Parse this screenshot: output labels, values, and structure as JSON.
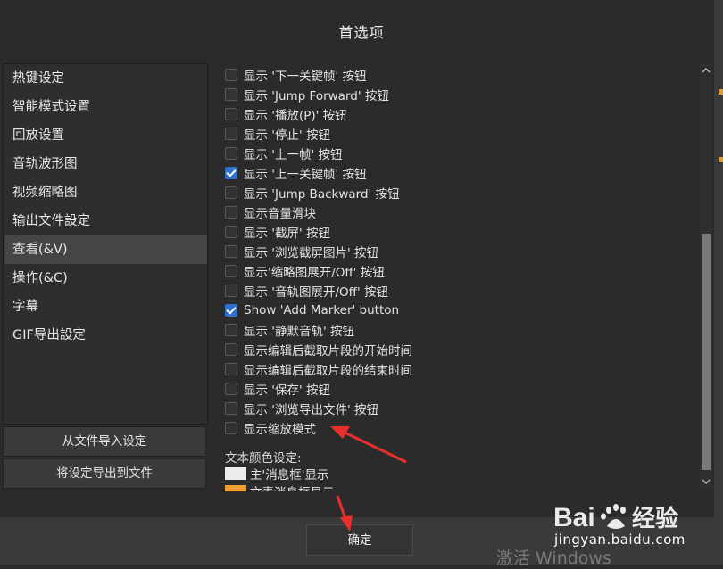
{
  "window": {
    "title": "首选项"
  },
  "sidebar": {
    "items": [
      {
        "label": "热键设定"
      },
      {
        "label": "智能模式设置"
      },
      {
        "label": "回放设置"
      },
      {
        "label": "音轨波形图"
      },
      {
        "label": "视频缩略图"
      },
      {
        "label": "输出文件設定"
      },
      {
        "label": "查看(&V)"
      },
      {
        "label": "操作(&C)"
      },
      {
        "label": "字幕"
      },
      {
        "label": "GIF导出設定"
      }
    ],
    "active_index": 6,
    "import_label": "从文件导入设定",
    "export_label": "将设定导出到文件"
  },
  "options": [
    {
      "label": "显示 '下一关键帧' 按钮",
      "checked": false
    },
    {
      "label": "显示 'Jump Forward' 按钮",
      "checked": false
    },
    {
      "label": "显示 '播放(P)' 按钮",
      "checked": false
    },
    {
      "label": "显示 '停止' 按钮",
      "checked": false
    },
    {
      "label": "显示 '上一帧' 按钮",
      "checked": false
    },
    {
      "label": "显示 '上一关键帧' 按钮",
      "checked": true
    },
    {
      "label": "显示 'Jump Backward' 按钮",
      "checked": false
    },
    {
      "label": "显示音量滑块",
      "checked": false
    },
    {
      "label": "显示 '截屏' 按钮",
      "checked": false
    },
    {
      "label": "显示 '浏览截屏图片' 按钮",
      "checked": false
    },
    {
      "label": "显示'缩略图展开/Off' 按钮",
      "checked": false
    },
    {
      "label": "显示 '音轨图展开/Off' 按钮",
      "checked": false
    },
    {
      "label": "Show 'Add Marker' button",
      "checked": true
    },
    {
      "label": "显示 '静默音轨' 按钮",
      "checked": false
    },
    {
      "label": "显示编辑后截取片段的开始时间",
      "checked": false
    },
    {
      "label": "显示编辑后截取片段的结束时间",
      "checked": false
    },
    {
      "label": "显示 '保存' 按钮",
      "checked": false
    },
    {
      "label": "显示 '浏览导出文件' 按钮",
      "checked": false
    },
    {
      "label": "显示缩放模式",
      "checked": false
    }
  ],
  "text_color": {
    "label": "文本颜色设定:",
    "items": [
      {
        "label": "主'消息框'显示",
        "color": "#ececec"
      },
      {
        "label": "文素消息框显示",
        "color": "#f0a030"
      }
    ]
  },
  "footer": {
    "ok_label": "确定"
  },
  "watermark": {
    "text": "激活 Windows"
  },
  "baidu": {
    "logo_text": "Bai经验",
    "url": "jingyan.baidu.com"
  },
  "colors": {
    "accent": "#2f6fd0",
    "arrow": "#e8302a"
  }
}
